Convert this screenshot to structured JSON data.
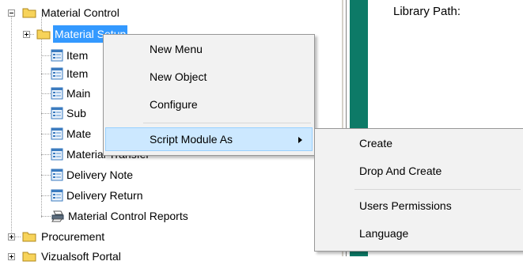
{
  "tree": {
    "items": [
      {
        "label": "Material Control"
      },
      {
        "label": "Material Setup"
      },
      {
        "label": "Item"
      },
      {
        "label": "Item"
      },
      {
        "label": "Main"
      },
      {
        "label": "Sub"
      },
      {
        "label": "Mate"
      },
      {
        "label": "Material Transfer"
      },
      {
        "label": "Delivery Note"
      },
      {
        "label": "Delivery Return"
      },
      {
        "label": "Material Control Reports"
      },
      {
        "label": "Procurement"
      },
      {
        "label": "Vizualsoft Portal"
      }
    ]
  },
  "right_pane": {
    "library_path_label": "Library Path:"
  },
  "context_menu": {
    "items": [
      {
        "label": "New Menu"
      },
      {
        "label": "New Object"
      },
      {
        "label": "Configure"
      },
      {
        "label": "Script Module As"
      }
    ]
  },
  "submenu": {
    "items": [
      {
        "label": "Create"
      },
      {
        "label": "Drop And Create"
      },
      {
        "label": "Users Permissions"
      },
      {
        "label": "Language"
      }
    ]
  },
  "colors": {
    "selection": "#3399ff",
    "menu_hover": "#cce8ff",
    "menu_background": "#f2f2f2",
    "accent_bar": "#0d7a67",
    "folder_yellow": "#f7d35a"
  },
  "icons": {
    "folder": "folder-icon",
    "form": "form-icon",
    "report": "printer-icon",
    "expand": "plus-expander-icon",
    "collapse": "minus-expander-icon",
    "submenu": "submenu-arrow-icon"
  }
}
